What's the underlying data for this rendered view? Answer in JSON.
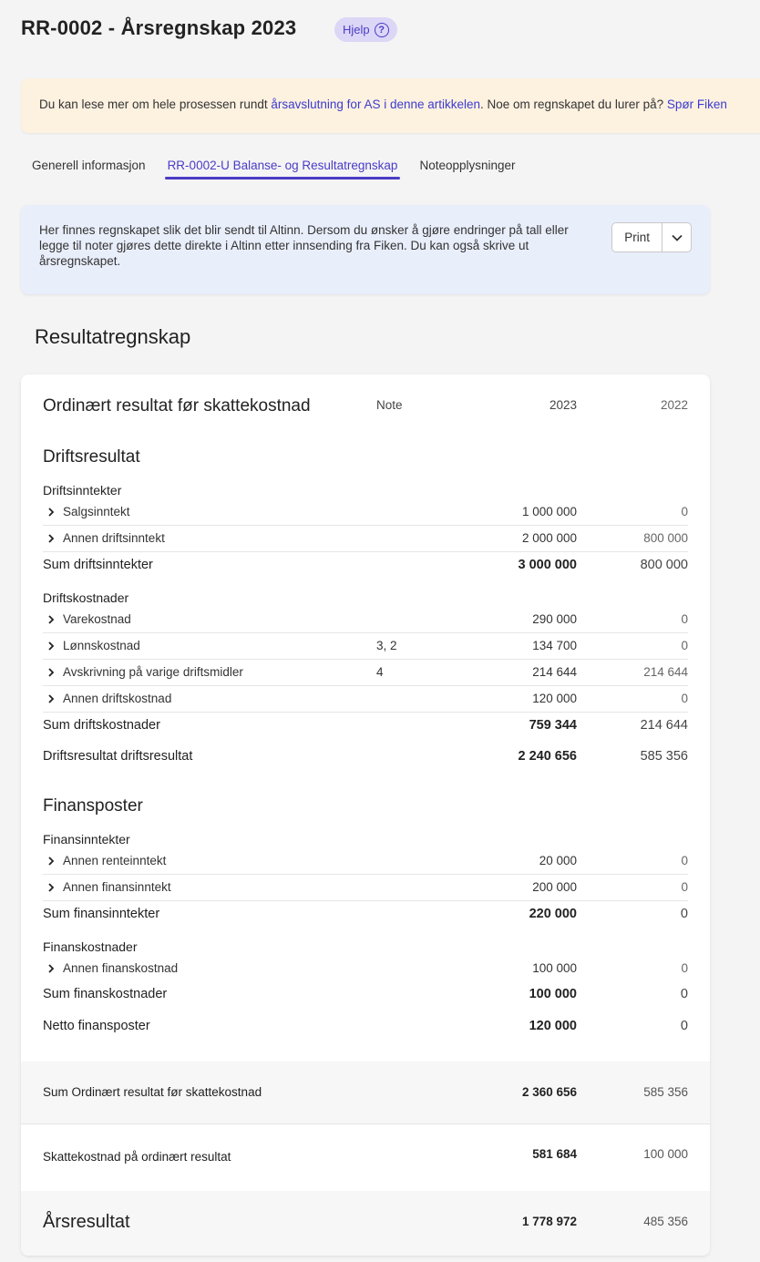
{
  "header": {
    "title": "RR-0002 - Årsregnskap 2023",
    "help_label": "Hjelp",
    "help_icon": "question-circle-icon"
  },
  "banner": {
    "text_before": "Du kan lese mer om hele prosessen rundt ",
    "link1": "årsavslutning for AS i denne artikkelen",
    "text_middle": ". Noe om regnskapet du lurer på? ",
    "link2": "Spør Fiken"
  },
  "tabs": [
    {
      "label": "Generell informasjon"
    },
    {
      "label": "RR-0002-U Balanse- og Resultatregnskap"
    },
    {
      "label": "Noteopplysninger"
    }
  ],
  "info": {
    "text": "Her finnes regnskapet slik det blir sendt til Altinn. Dersom du ønsker å gjøre endringer på tall eller legge til noter gjøres dette direkte i Altinn etter innsending fra Fiken. Du kan også skrive ut årsregnskapet.",
    "print_label": "Print"
  },
  "section_title": "Resultatregnskap",
  "table": {
    "title": "Ordinært resultat før skattekostnad",
    "col_note": "Note",
    "col_2023": "2023",
    "col_2022": "2022",
    "drift": {
      "title": "Driftsresultat",
      "inntekter_title": "Driftsinntekter",
      "inntekter": [
        {
          "label": "Salgsinntekt",
          "note": "",
          "v2023": "1 000 000",
          "v2022": "0"
        },
        {
          "label": "Annen driftsinntekt",
          "note": "",
          "v2023": "2 000 000",
          "v2022": "800 000"
        }
      ],
      "sum_inntekter": {
        "label": "Sum driftsinntekter",
        "v2023": "3 000 000",
        "v2022": "800 000"
      },
      "kostnader_title": "Driftskostnader",
      "kostnader": [
        {
          "label": "Varekostnad",
          "note": "",
          "v2023": "290 000",
          "v2022": "0"
        },
        {
          "label": "Lønnskostnad",
          "note": "3, 2",
          "v2023": "134 700",
          "v2022": "0"
        },
        {
          "label": "Avskrivning på varige driftsmidler",
          "note": "4",
          "v2023": "214 644",
          "v2022": "214 644"
        },
        {
          "label": "Annen driftskostnad",
          "note": "",
          "v2023": "120 000",
          "v2022": "0"
        }
      ],
      "sum_kostnader": {
        "label": "Sum driftskostnader",
        "v2023": "759 344",
        "v2022": "214 644"
      },
      "resultat": {
        "label": "Driftsresultat driftsresultat",
        "v2023": "2 240 656",
        "v2022": "585 356"
      }
    },
    "finans": {
      "title": "Finansposter",
      "inntekter_title": "Finansinntekter",
      "inntekter": [
        {
          "label": "Annen renteinntekt",
          "note": "",
          "v2023": "20 000",
          "v2022": "0"
        },
        {
          "label": "Annen finansinntekt",
          "note": "",
          "v2023": "200 000",
          "v2022": "0"
        }
      ],
      "sum_inntekter": {
        "label": "Sum finansinntekter",
        "v2023": "220 000",
        "v2022": "0"
      },
      "kostnader_title": "Finanskostnader",
      "kostnader": [
        {
          "label": "Annen finanskostnad",
          "note": "",
          "v2023": "100 000",
          "v2022": "0"
        }
      ],
      "sum_kostnader": {
        "label": "Sum finanskostnader",
        "v2023": "100 000",
        "v2022": "0"
      },
      "netto": {
        "label": "Netto finansposter",
        "v2023": "120 000",
        "v2022": "0"
      }
    },
    "sum_ordinaert": {
      "label": "Sum Ordinært resultat før skattekostnad",
      "v2023": "2 360 656",
      "v2022": "585 356"
    },
    "skatt": {
      "label": "Skattekostnad på ordinært resultat",
      "v2023": "581 684",
      "v2022": "100 000"
    },
    "aarsresultat": {
      "label": "Årsresultat",
      "v2023": "1 778 972",
      "v2022": "485 356"
    }
  }
}
